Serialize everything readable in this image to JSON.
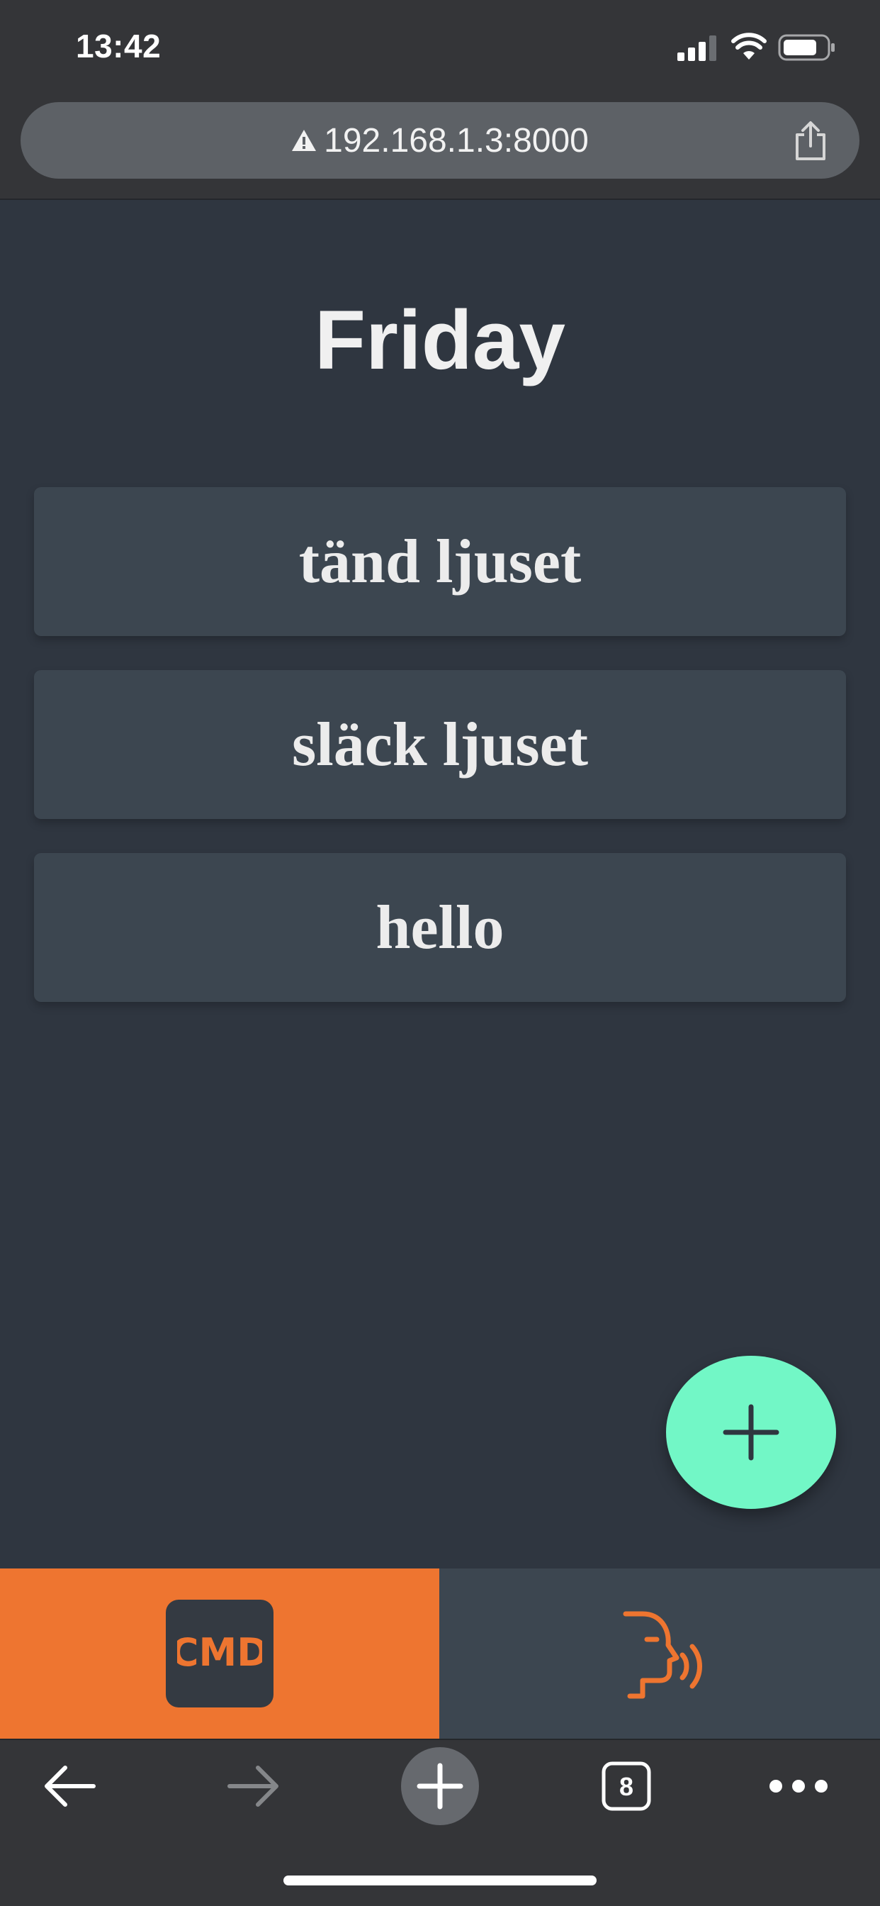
{
  "status_bar": {
    "time": "13:42",
    "icons": [
      "cellular-signal-icon",
      "wifi-icon",
      "battery-icon"
    ]
  },
  "browser": {
    "url": "192.168.1.3:8000",
    "security_icon": "warning-triangle-icon",
    "share_icon": "share-icon",
    "tab_count": "8",
    "toolbar_icons": [
      "back-arrow-icon",
      "forward-arrow-icon",
      "plus-icon",
      "tabs-icon",
      "more-icon"
    ]
  },
  "app": {
    "title": "Friday",
    "commands": [
      {
        "label": "tänd ljuset"
      },
      {
        "label": "släck ljuset"
      },
      {
        "label": "hello"
      }
    ],
    "fab_icon": "plus-icon",
    "tabs": [
      {
        "name": "cmd",
        "label": "CMD",
        "active": true
      },
      {
        "name": "voice",
        "icon": "speaking-head-icon",
        "active": false
      }
    ]
  },
  "colors": {
    "background": "#2f3640",
    "card": "#3c4650",
    "accent_orange": "#ee7530",
    "fab_green": "#72f7c6",
    "browser_chrome": "#343538"
  }
}
